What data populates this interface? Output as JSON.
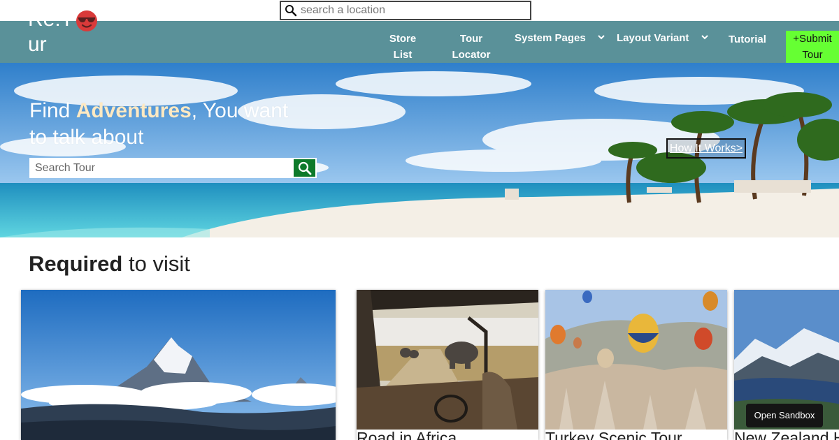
{
  "top_search": {
    "placeholder": "search a location"
  },
  "logo": {
    "line1": "Re:T",
    "line2": "ur"
  },
  "nav": {
    "store_list": "Store List",
    "tour_locator": "Tour Locator",
    "system_pages": "System Pages",
    "layout_variant": "Layout Variant",
    "tutorial": "Tutorial",
    "submit_tour": "+Submit Tour",
    "accent_color": "#66ff33",
    "bar_color": "#5a9199"
  },
  "hero": {
    "title_prefix": "Find ",
    "title_bold": "Adventures",
    "title_suffix": ", You want to talk about",
    "search_placeholder": "Search Tour",
    "how_it_works": "How It Works>"
  },
  "section": {
    "title_bold": "Required",
    "title_rest": " to visit"
  },
  "cards": [
    {
      "caption": "",
      "scene": "mountain"
    },
    {
      "caption": "Road in Africa",
      "scene": "safari"
    },
    {
      "caption": "Turkey Scenic Tour",
      "scene": "balloons"
    },
    {
      "caption": "New Zealand H",
      "scene": "lake"
    }
  ],
  "sandbox": {
    "label": "Open Sandbox"
  }
}
